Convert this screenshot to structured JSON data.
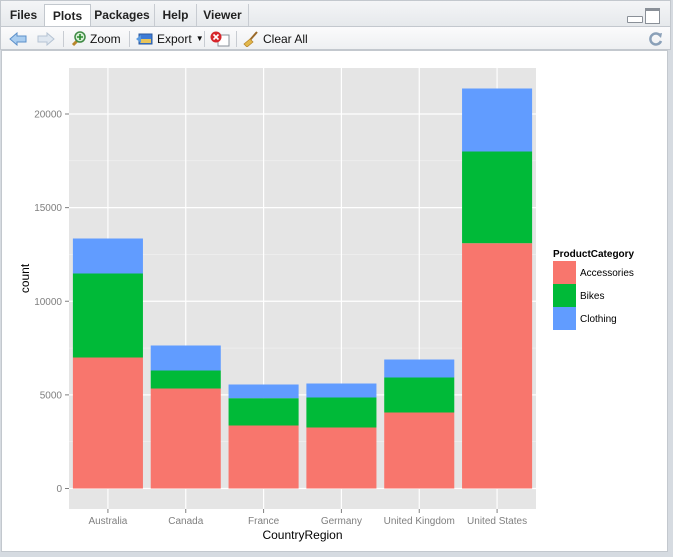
{
  "tabs": [
    {
      "label": "Files",
      "active": false
    },
    {
      "label": "Plots",
      "active": true
    },
    {
      "label": "Packages",
      "active": false
    },
    {
      "label": "Help",
      "active": false
    },
    {
      "label": "Viewer",
      "active": false
    }
  ],
  "toolbar": {
    "zoom_label": "Zoom",
    "export_label": "Export",
    "clear_all_label": "Clear All"
  },
  "chart_data": {
    "type": "bar",
    "stacked": true,
    "title": "",
    "xlabel": "CountryRegion",
    "ylabel": "count",
    "ylim": [
      0,
      22500
    ],
    "yticks": [
      0,
      5000,
      10000,
      15000,
      20000
    ],
    "ytick_labels": [
      "0",
      "5000",
      "10000",
      "15000",
      "20000"
    ],
    "categories": [
      "Australia",
      "Canada",
      "France",
      "Germany",
      "United Kingdom",
      "United States"
    ],
    "legend": {
      "title": "ProductCategory",
      "placement": "right"
    },
    "grid": true,
    "series": [
      {
        "name": "Accessories",
        "color": "#F8766D",
        "values": [
          6996,
          5340,
          3364,
          3258,
          4059,
          13100
        ]
      },
      {
        "name": "Bikes",
        "color": "#00BA38",
        "values": [
          4486,
          962,
          1459,
          1602,
          1869,
          4897
        ]
      },
      {
        "name": "Clothing",
        "color": "#619CFF",
        "values": [
          1869,
          1335,
          731,
          747,
          961,
          3365
        ]
      }
    ]
  }
}
